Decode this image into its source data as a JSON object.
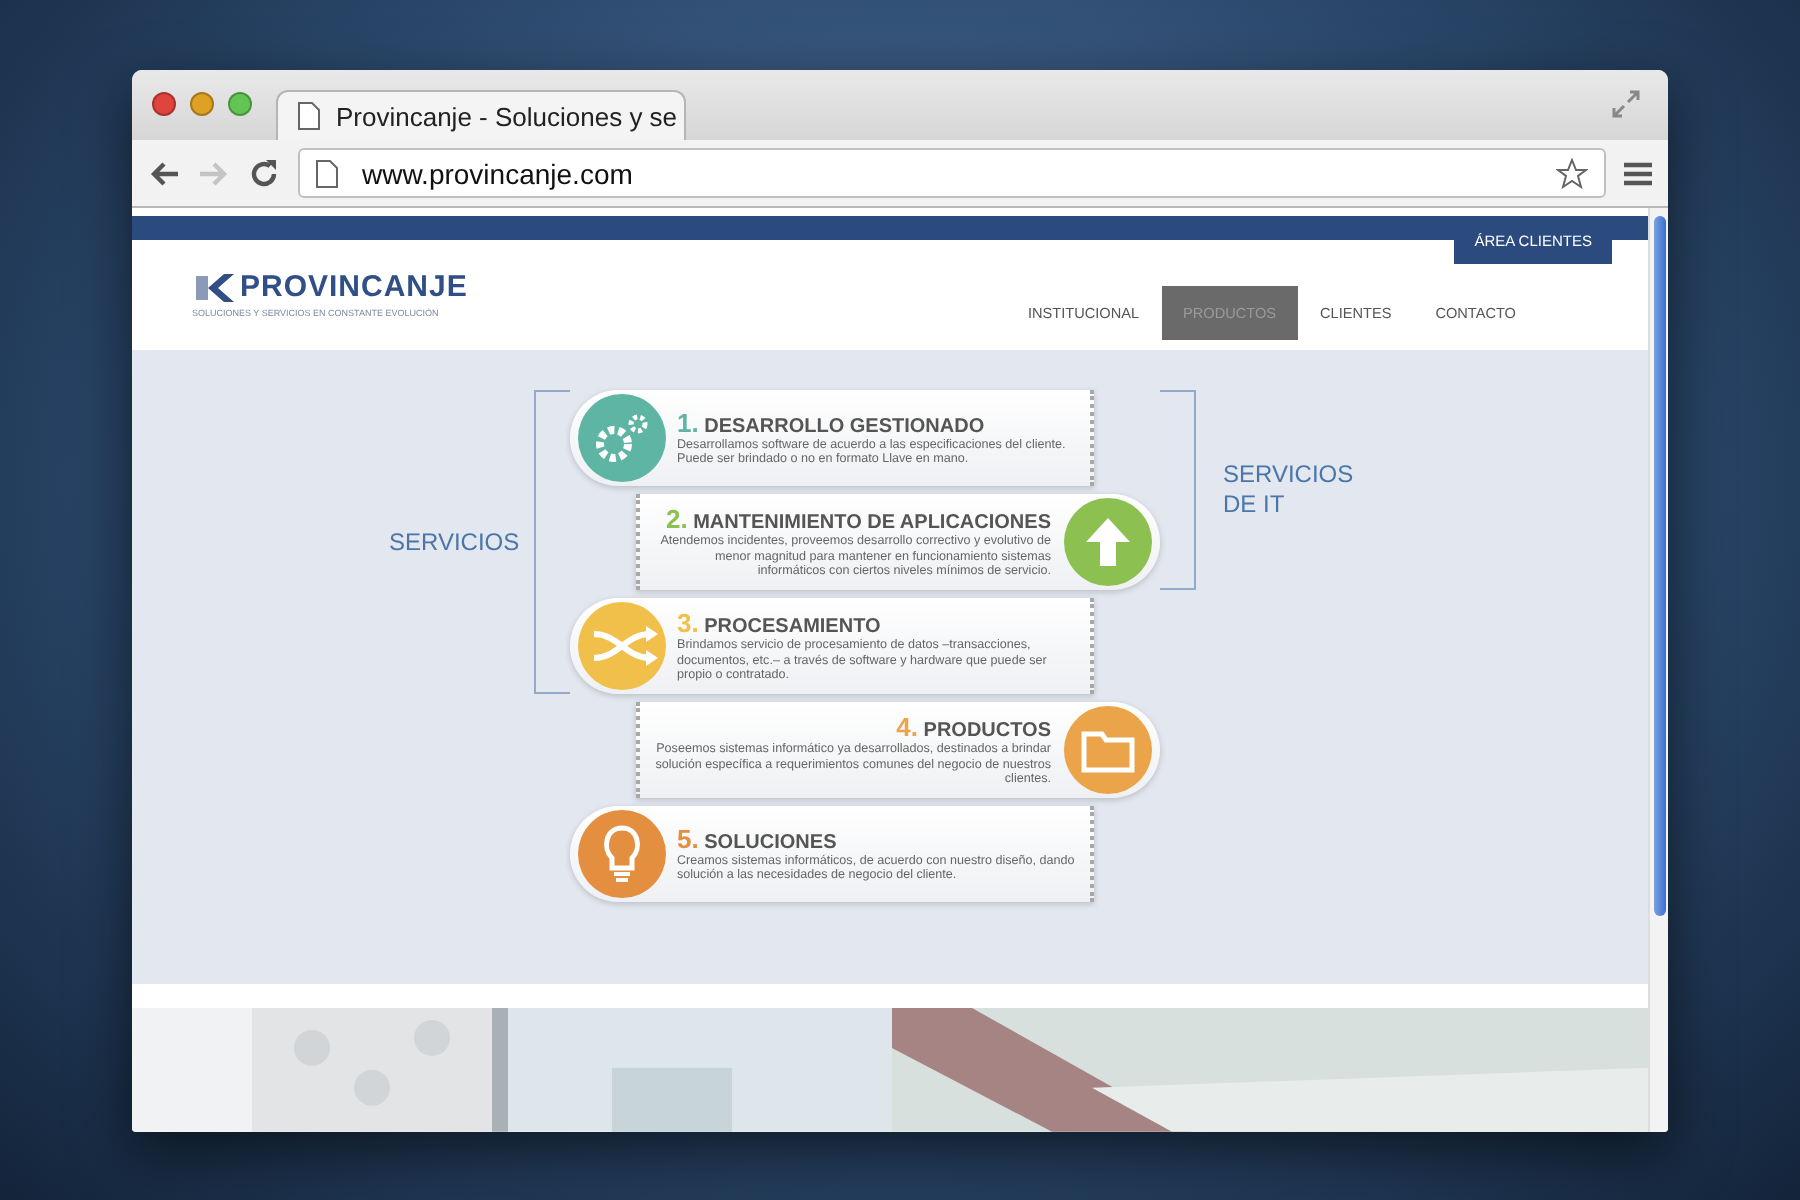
{
  "browser": {
    "tab_title": "Provincanje - Soluciones y se",
    "url": "www.provincanje.com",
    "forward_disabled": true
  },
  "header": {
    "client_area": "ÁREA CLIENTES",
    "logo": "PROVINCANJE",
    "tagline": "SOLUCIONES Y SERVICIOS EN CONSTANTE EVOLUCIÓN",
    "nav": [
      {
        "label": "INSTITUCIONAL",
        "selected": false
      },
      {
        "label": "PRODUCTOS",
        "selected": true
      },
      {
        "label": "CLIENTES",
        "selected": false
      },
      {
        "label": "CONTACTO",
        "selected": false
      }
    ]
  },
  "infographic": {
    "left_label": "SERVICIOS",
    "right_label": "SERVICIOS DE IT",
    "items": [
      {
        "kind": "icon-left",
        "number": "1.",
        "title": "DESARROLLO GESTIONADO",
        "text": "Desarrollamos software de acuerdo a las especificaciones del cliente. Puede ser brindado o no en formato Llave en mano.",
        "color": "#5fb5a3"
      },
      {
        "kind": "icon-right",
        "number": "2.",
        "title": "MANTENIMIENTO DE APLICACIONES",
        "text": "Atendemos incidentes, proveemos desarrollo correctivo y evolutivo de menor magnitud para mantener en funcionamiento sistemas informáticos con ciertos niveles mínimos de servicio.",
        "color": "#8cc152"
      },
      {
        "kind": "icon-left",
        "number": "3.",
        "title": "PROCESAMIENTO",
        "text": "Brindamos servicio de procesamiento de datos –transacciones, documentos, etc.– a través de software y hardware que puede ser propio o contratado.",
        "color": "#f0c04a"
      },
      {
        "kind": "icon-right",
        "number": "4.",
        "title": "PRODUCTOS",
        "text": "Poseemos sistemas informático ya desarrollados, destinados a brindar solución específica a requerimientos comunes del negocio de nuestros clientes.",
        "color": "#eba44a"
      },
      {
        "kind": "icon-left",
        "number": "5.",
        "title": "SOLUCIONES",
        "text": "Creamos sistemas informáticos, de acuerdo con nuestro diseño, dando solución a las necesidades de negocio del cliente.",
        "color": "#e38f3f"
      }
    ]
  }
}
